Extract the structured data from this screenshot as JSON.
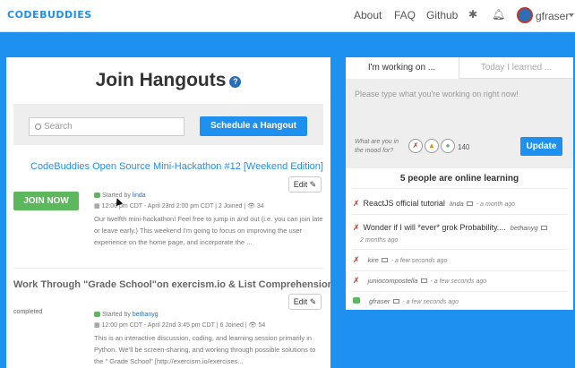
{
  "nav": {
    "logo": "CODEBUDDIES",
    "links": [
      "About",
      "FAQ",
      "Github"
    ],
    "icons": [
      "puzzle-icon",
      "bell-icon"
    ],
    "username": "gfraser"
  },
  "main": {
    "title": "Join Hangouts",
    "search_placeholder": "Search",
    "schedule_label": "Schedule a Hangout",
    "hangouts": [
      {
        "title": "CodeBuddies Open Source Mini-Hackathon #12 [Weekend Edition]",
        "edit_label": "Edit",
        "action_label": "JOIN NOW",
        "started_prefix": "Started by",
        "started_by": "linda",
        "meta": "12:00 pm CDT - April 23rd 2:00 pm CDT | 2 Joined | 👁 34",
        "description": "Our twelfth mini-hackathon! Feel free to jump in and out (i.e. you can join late or leave early.) This weekend I'm going to focus on improving the user experience on the home page, and incorporate the ..."
      },
      {
        "title": "Work Through \"Grade School\"on exercism.io & List Comprehensions",
        "edit_label": "Edit",
        "status": "completed",
        "started_prefix": "Started by",
        "started_by": "bethanyg",
        "meta": "12:00 pm CDT - April 22nd 3:45 pm CDT | 6 Joined | 👁 54",
        "description": "This is an interactive discussion, coding, and learning session primarily in Python. We'll be screen-sharing, and working through possible solutions to the \" Grade School\" [http://exercism.io/exercises..."
      }
    ]
  },
  "sidebar": {
    "tabs": [
      "I'm working on ...",
      "Today I learned ..."
    ],
    "placeholder": "Please type what you're working on right now!",
    "mood_label": "What are you in the mood for?",
    "mood_count": "140",
    "update_label": "Update",
    "online_header": "5 people are online learning",
    "online": [
      {
        "text": "ReactJS official tutorial",
        "user": "linda",
        "time": "- a month ago",
        "icon": "red"
      },
      {
        "text": "Wonder if I will *ever* grok Probability....",
        "user": "bethanyg",
        "time": "2 months ago",
        "icon": "red"
      },
      {
        "text": "",
        "user": "kire",
        "time": "- a few seconds ago",
        "icon": "red"
      },
      {
        "text": "",
        "user": "juniocompostella",
        "time": "- a few seconds ago",
        "icon": "red"
      },
      {
        "text": "",
        "user": "gfraser",
        "time": "- a few seconds ago",
        "icon": "green"
      }
    ]
  }
}
